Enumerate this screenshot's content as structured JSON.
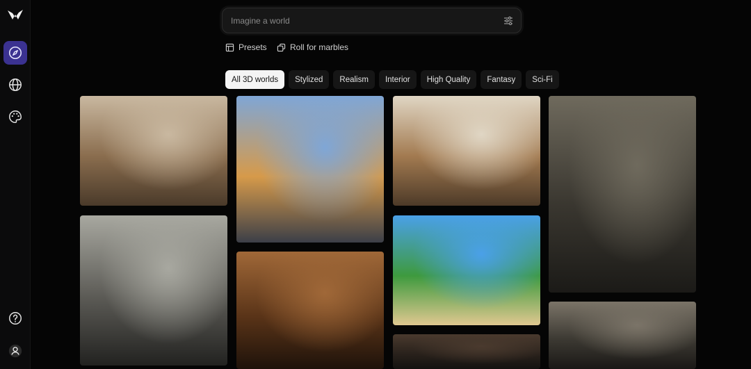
{
  "search": {
    "placeholder": "Imagine a world"
  },
  "actions": {
    "presets": "Presets",
    "roll": "Roll for marbles"
  },
  "tabs": [
    {
      "label": "All 3D worlds",
      "active": true
    },
    {
      "label": "Stylized",
      "active": false
    },
    {
      "label": "Realism",
      "active": false
    },
    {
      "label": "Interior",
      "active": false
    },
    {
      "label": "High Quality",
      "active": false
    },
    {
      "label": "Fantasy",
      "active": false
    },
    {
      "label": "Sci-Fi",
      "active": false
    }
  ],
  "sidebar": {
    "items": [
      {
        "icon": "compass-icon",
        "active": true
      },
      {
        "icon": "globe-icon",
        "active": false
      },
      {
        "icon": "palette-icon",
        "active": false
      }
    ],
    "bottom": [
      {
        "icon": "help-icon"
      },
      {
        "icon": "user-icon"
      }
    ]
  },
  "colors": {
    "accent": "#3b3291",
    "background": "#050505"
  },
  "gallery": [
    {
      "scene": "medieval-street",
      "palette": [
        "#c9b8a0",
        "#8a6d4e",
        "#4a3a2a"
      ]
    },
    {
      "scene": "lisbon-tram-street",
      "palette": [
        "#7fa6d6",
        "#d69a4a",
        "#3c3f48"
      ]
    },
    {
      "scene": "cozy-bedroom-study",
      "palette": [
        "#e0d6c4",
        "#a27a50",
        "#4d3a28"
      ]
    },
    {
      "scene": "dark-office",
      "palette": [
        "#6f6a5d",
        "#3a3730",
        "#1b1a17"
      ]
    },
    {
      "scene": "scifi-control-room",
      "palette": [
        "#a8a8a0",
        "#5b5a55",
        "#222220"
      ]
    },
    {
      "scene": "stylized-island",
      "palette": [
        "#4aa0e8",
        "#3e9a3e",
        "#e0c890"
      ]
    },
    {
      "scene": "wooden-tavern",
      "palette": [
        "#a06838",
        "#5a3418",
        "#1e120a"
      ]
    },
    {
      "scene": "stone-vault",
      "palette": [
        "#4a3a2e",
        "#2a221c",
        "#141210"
      ]
    },
    {
      "scene": "rustic-barn",
      "palette": [
        "#7b7468",
        "#3d3a33",
        "#1a1816"
      ]
    }
  ]
}
